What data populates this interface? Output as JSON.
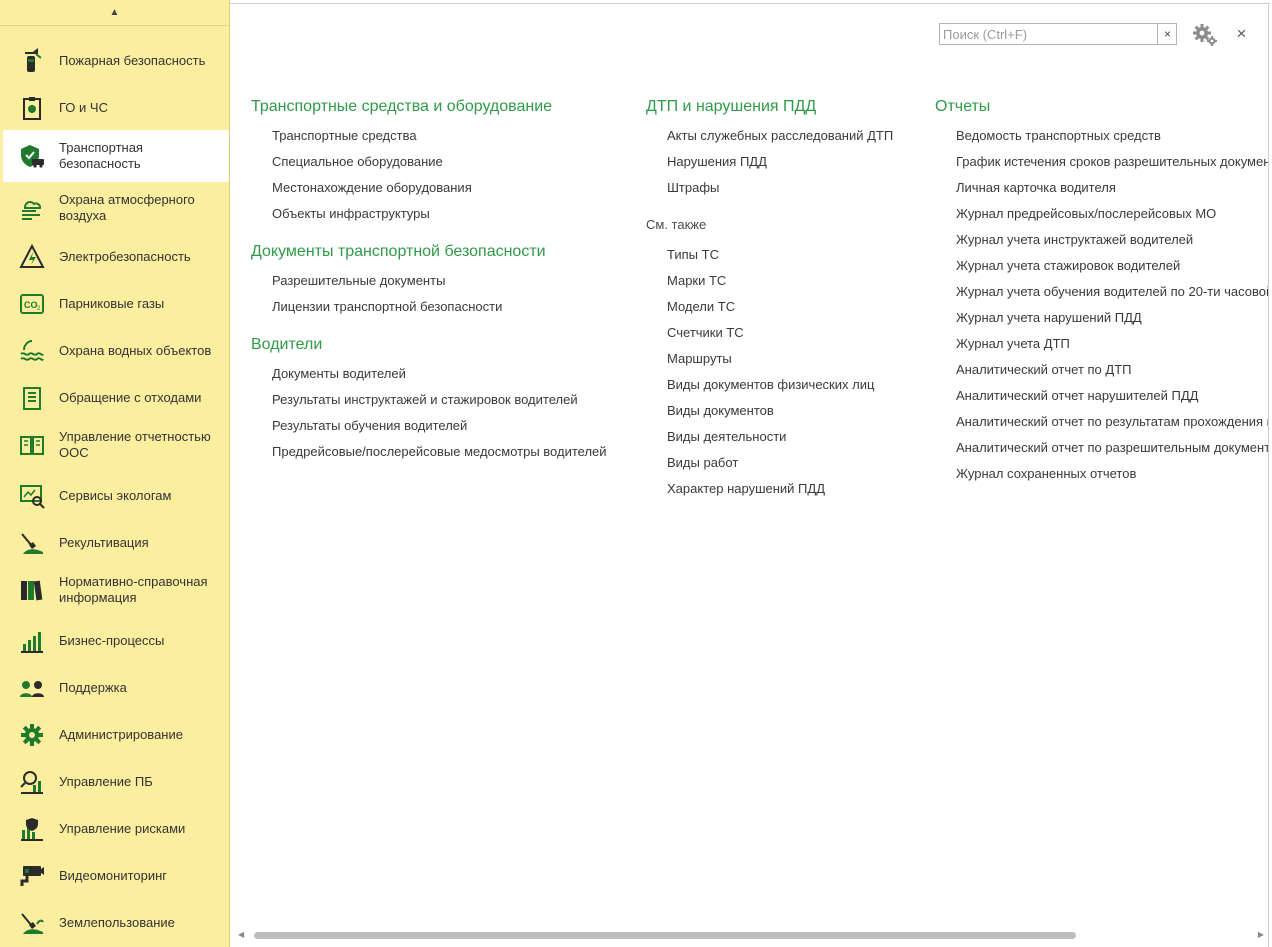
{
  "sidebar": {
    "scroll_up": "▲",
    "items": [
      {
        "label": "Пожарная безопасность",
        "icon": "fire-extinguisher-icon"
      },
      {
        "label": "ГО и ЧС",
        "icon": "civil-defense-icon"
      },
      {
        "label": "Транспортная безопасность",
        "icon": "transport-security-icon",
        "active": true
      },
      {
        "label": "Охрана атмосферного воздуха",
        "icon": "air-protection-icon"
      },
      {
        "label": "Электробезопасность",
        "icon": "electric-hazard-icon"
      },
      {
        "label": "Парниковые газы",
        "icon": "co2-icon"
      },
      {
        "label": "Охрана водных объектов",
        "icon": "water-waves-icon"
      },
      {
        "label": "Обращение с отходами",
        "icon": "waste-icon"
      },
      {
        "label": "Управление отчетностью ООС",
        "icon": "report-book-icon"
      },
      {
        "label": "Сервисы экологам",
        "icon": "eco-services-icon"
      },
      {
        "label": "Рекультивация",
        "icon": "recultivation-icon"
      },
      {
        "label": "Нормативно-справочная информация",
        "icon": "binders-icon"
      },
      {
        "label": "Бизнес-процессы",
        "icon": "bar-chart-icon"
      },
      {
        "label": "Поддержка",
        "icon": "support-icon"
      },
      {
        "label": "Администрирование",
        "icon": "gear-icon"
      },
      {
        "label": "Управление ПБ",
        "icon": "magnifier-chart-icon"
      },
      {
        "label": "Управление рисками",
        "icon": "risk-shield-icon"
      },
      {
        "label": "Видеомониторинг",
        "icon": "camera-icon"
      },
      {
        "label": "Землепользование",
        "icon": "land-use-icon"
      }
    ]
  },
  "search": {
    "placeholder": "Поиск (Ctrl+F)",
    "value": "",
    "clear_label": "×"
  },
  "close_label": "×",
  "columns": [
    {
      "groups": [
        {
          "title": "Транспортные средства и оборудование",
          "links": [
            "Транспортные средства",
            "Специальное оборудование",
            "Местонахождение оборудования",
            "Объекты инфраструктуры"
          ]
        },
        {
          "title": "Документы транспортной безопасности",
          "links": [
            "Разрешительные документы",
            "Лицензии транспортной безопасности"
          ]
        },
        {
          "title": "Водители",
          "links": [
            "Документы водителей",
            "Результаты инструктажей и стажировок водителей",
            "Результаты обучения водителей",
            "Предрейсовые/послерейсовые медосмотры водителей"
          ]
        }
      ]
    },
    {
      "groups": [
        {
          "title": "ДТП и нарушения ПДД",
          "links": [
            "Акты служебных расследований ДТП",
            "Нарушения ПДД",
            "Штрафы"
          ]
        }
      ],
      "see_also_label": "См. также",
      "see_also": [
        "Типы ТС",
        "Марки ТС",
        "Модели ТС",
        "Счетчики ТС",
        "Маршруты",
        "Виды документов физических лиц",
        "Виды документов",
        "Виды деятельности",
        "Виды работ",
        "Характер нарушений ПДД"
      ]
    },
    {
      "groups": [
        {
          "title": "Отчеты",
          "links": [
            "Ведомость транспортных средств",
            "График истечения сроков разрешительных докумен",
            "Личная карточка водителя",
            "Журнал предрейсовых/послерейсовых МО",
            "Журнал учета инструктажей водителей",
            "Журнал учета стажировок  водителей",
            "Журнал учета обучения водителей по 20-ти часовой",
            "Журнал учета нарушений ПДД",
            "Журнал учета ДТП",
            "Аналитический отчет по ДТП",
            "Аналитический отчет нарушителей ПДД",
            "Аналитический отчет по результатам прохождения м",
            "Аналитический отчет по разрешительным документ",
            "Журнал сохраненных отчетов"
          ]
        }
      ]
    }
  ],
  "colors": {
    "sidebar_bg": "#fbee9f",
    "accent_green": "#2f9a48",
    "icon_green": "#1f7a2e"
  }
}
